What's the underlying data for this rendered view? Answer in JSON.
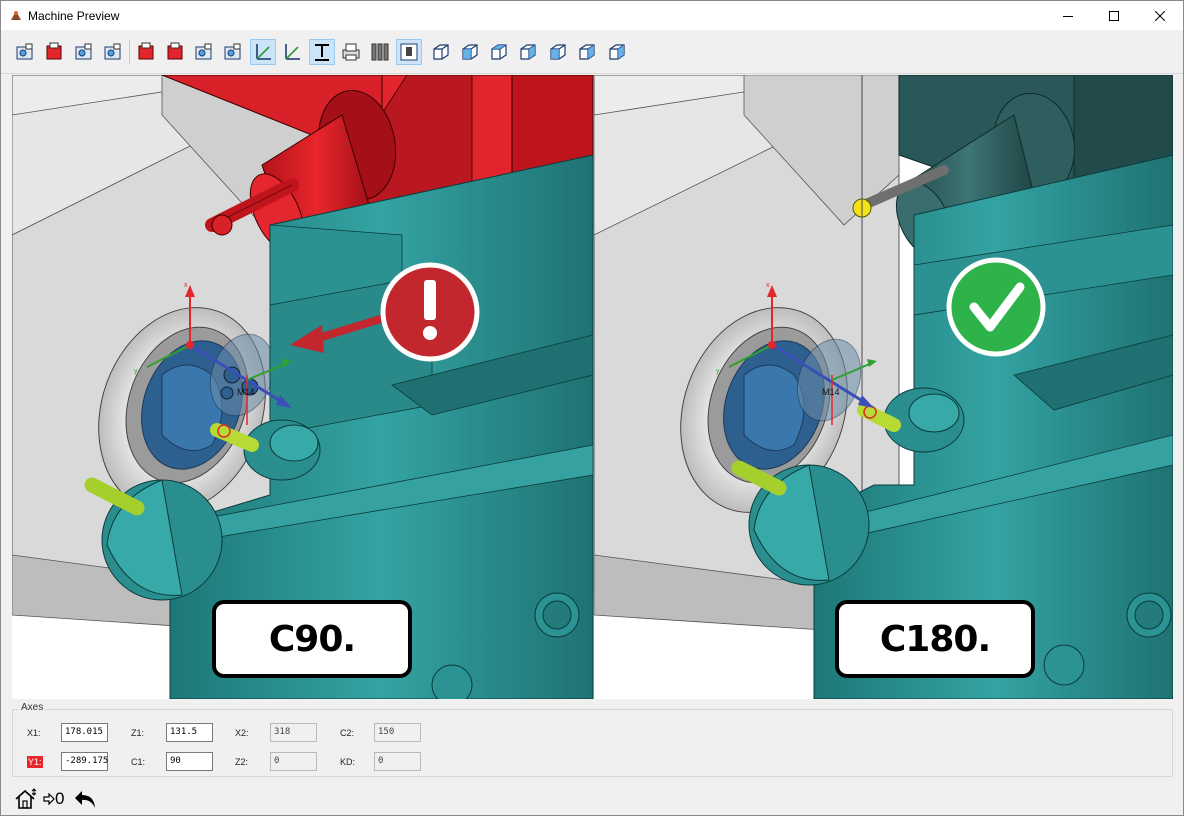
{
  "window": {
    "title": "Machine Preview"
  },
  "toolbar": {
    "buttons": [
      {
        "icon": "machine-view-icon"
      },
      {
        "icon": "machine-red-icon"
      },
      {
        "icon": "machine-gear-icon"
      },
      {
        "icon": "tool-holders-icon"
      },
      {
        "icon": "spindle-red-icon"
      },
      {
        "icon": "stock-red-icon"
      },
      {
        "icon": "stock-fixture-icon"
      },
      {
        "icon": "stock-sphere-icon"
      },
      {
        "icon": "axes-icon",
        "active": true
      },
      {
        "icon": "axes-alt-icon"
      },
      {
        "icon": "text-icon",
        "active": true
      },
      {
        "icon": "printer-icon"
      },
      {
        "icon": "tools-icon"
      },
      {
        "icon": "tool-frame-icon",
        "active": true
      },
      {
        "icon": "view-iso-icon"
      },
      {
        "icon": "view-front-icon"
      },
      {
        "icon": "view-top-icon"
      },
      {
        "icon": "view-right-icon"
      },
      {
        "icon": "view-left-icon"
      },
      {
        "icon": "view-back-icon"
      },
      {
        "icon": "view-bottom-icon"
      }
    ]
  },
  "viewport": {
    "left_label": "C90.",
    "right_label": "C180.",
    "left_status": "warning",
    "right_status": "ok",
    "axis_marker": "M14",
    "colors": {
      "collision": "#d72027",
      "turret": "#2e8b8b",
      "ok": "#2db34a",
      "warning": "#c1272d"
    }
  },
  "axes": {
    "legend": "Axes",
    "fields": [
      {
        "label": "X1:",
        "value": "178.015"
      },
      {
        "label": "Y1:",
        "value": "-289.175",
        "highlight": true
      },
      {
        "label": "Z1:",
        "value": "131.5"
      },
      {
        "label": "C1:",
        "value": "90"
      },
      {
        "label": "X2:",
        "value": "318",
        "readonly": true
      },
      {
        "label": "Z2:",
        "value": "0",
        "readonly": true
      },
      {
        "label": "C2:",
        "value": "150",
        "readonly": true
      },
      {
        "label": "KD:",
        "value": "0",
        "readonly": true
      }
    ]
  },
  "bottombar": {
    "zero_label": "0"
  }
}
